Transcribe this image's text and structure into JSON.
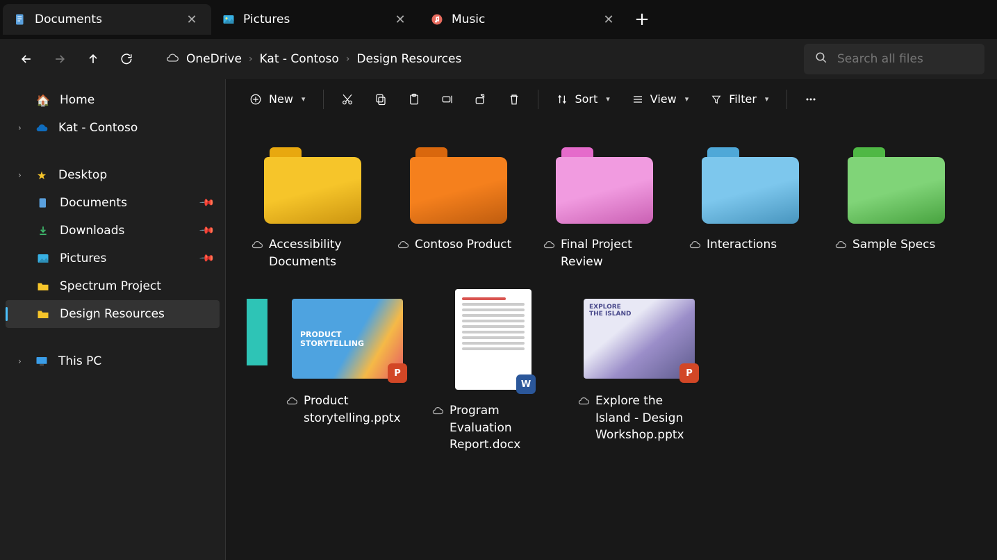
{
  "tabs": [
    {
      "label": "Documents",
      "icon": "doc",
      "active": true
    },
    {
      "label": "Pictures",
      "icon": "pic",
      "active": false
    },
    {
      "label": "Music",
      "icon": "music",
      "active": false
    }
  ],
  "breadcrumb": [
    "OneDrive",
    "Kat - Contoso",
    "Design Resources"
  ],
  "search": {
    "placeholder": "Search all files"
  },
  "sidebar": {
    "top": [
      {
        "label": "Home",
        "icon": "home"
      },
      {
        "label": "Kat - Contoso",
        "icon": "onedrive",
        "expandable": true
      }
    ],
    "quick": [
      {
        "label": "Desktop",
        "icon": "star",
        "expandable": true
      },
      {
        "label": "Documents",
        "icon": "doc",
        "pinned": true
      },
      {
        "label": "Downloads",
        "icon": "download",
        "pinned": true
      },
      {
        "label": "Pictures",
        "icon": "pic",
        "pinned": true
      },
      {
        "label": "Spectrum Project",
        "icon": "folder"
      },
      {
        "label": "Design Resources",
        "icon": "folder",
        "selected": true
      }
    ],
    "bottom": [
      {
        "label": "This PC",
        "icon": "pc",
        "expandable": true
      }
    ]
  },
  "toolbar": {
    "new": "New",
    "sort": "Sort",
    "view": "View",
    "filter": "Filter"
  },
  "folders": [
    {
      "name": "Accessibility Documents",
      "color": "#f6c52a",
      "tab": "#e8a80f"
    },
    {
      "name": "Contoso Product",
      "color": "#f5801d",
      "tab": "#d9670d"
    },
    {
      "name": "Final Project Review",
      "color": "#f19be0",
      "tab": "#e56bcb"
    },
    {
      "name": "Interactions",
      "color": "#7dc7ed",
      "tab": "#4fa8d8"
    },
    {
      "name": "Sample Specs",
      "color": "#80d478",
      "tab": "#4fb845"
    }
  ],
  "files": [
    {
      "name": "Product storytelling.pptx",
      "type": "pptx",
      "thumb": "ppt-blue"
    },
    {
      "name": "Program Evaluation Report.docx",
      "type": "docx",
      "thumb": "doc"
    },
    {
      "name": "Explore the Island - Design Workshop.pptx",
      "type": "pptx",
      "thumb": "ppt-island"
    }
  ],
  "colors": {
    "pptx": "#d24726",
    "docx": "#2b579a"
  }
}
